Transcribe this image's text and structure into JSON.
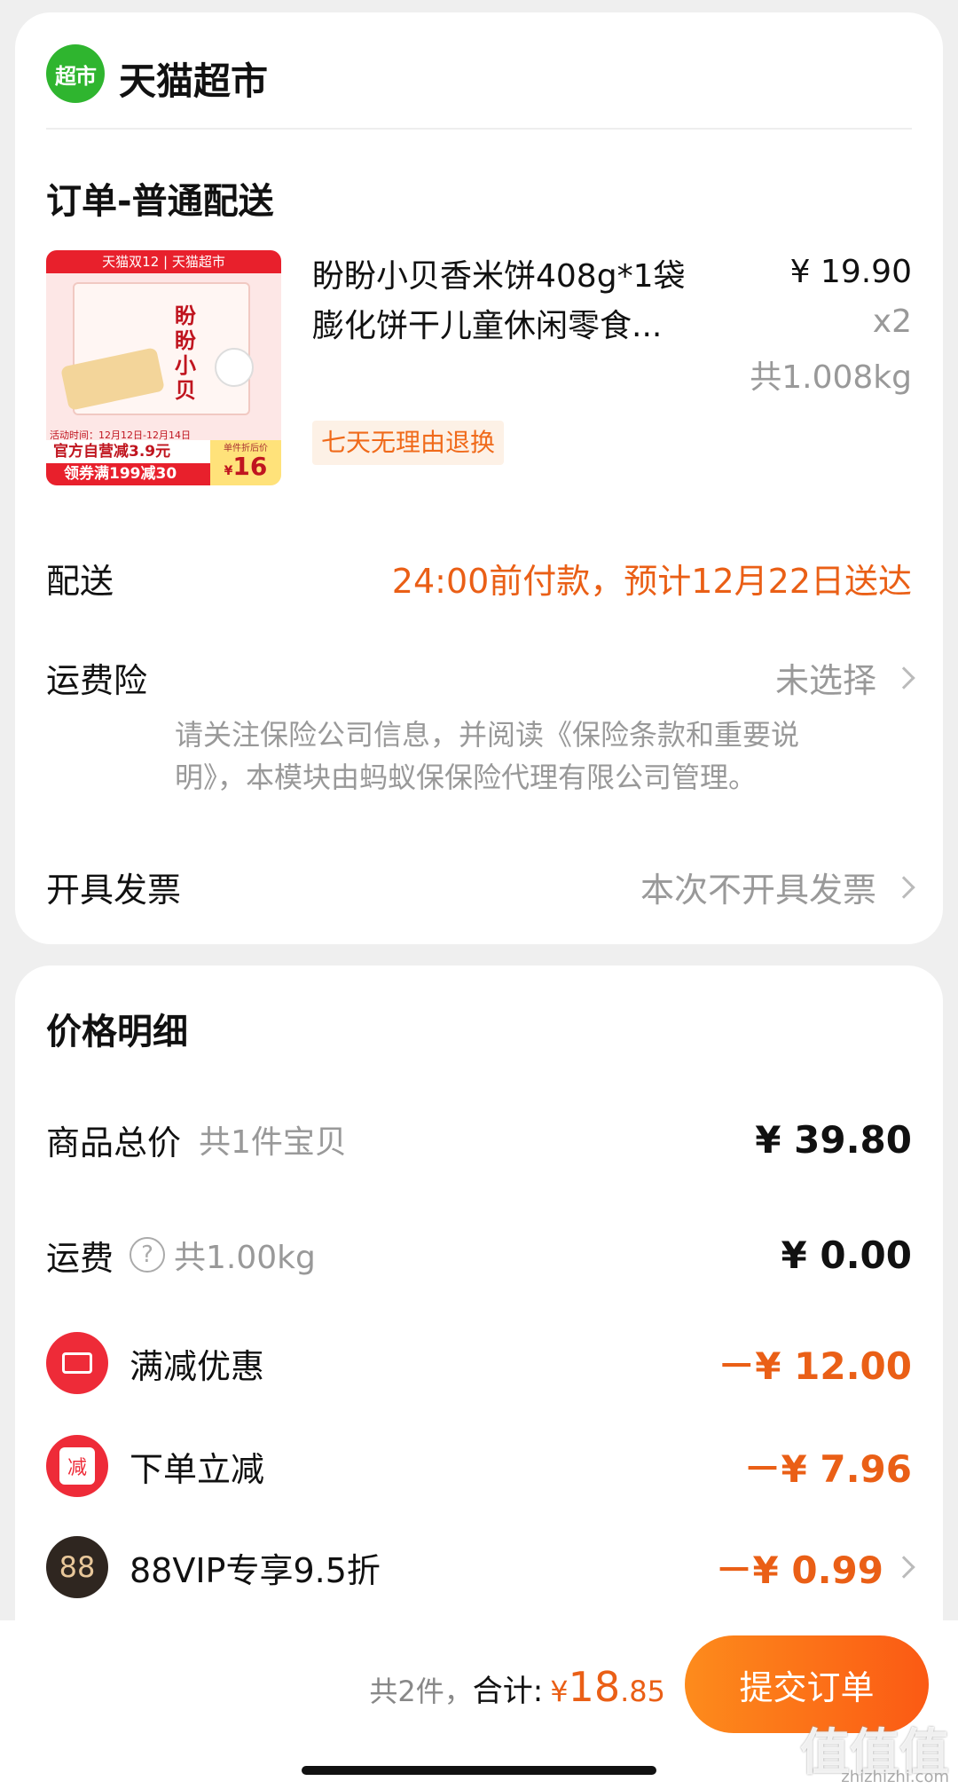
{
  "store": {
    "logo_text": "超市",
    "name": "天猫超市"
  },
  "order": {
    "title": "订单-普通配送",
    "thumbnail": {
      "banner": "天猫双12 | 天猫超市",
      "brand_text": "盼盼小贝",
      "event_dates": "活动时间：12月12日-12月14日",
      "promo1": "官方自营减3.9元",
      "promo2": "领券满199减30",
      "unit_label": "单件折后价",
      "unit_price": "16",
      "yen": "¥"
    },
    "product": {
      "name": "盼盼小贝香米饼408g*1袋膨化饼干儿童休闲零食...",
      "price": "¥ 19.90",
      "qty": "x2",
      "weight": "共1.008kg",
      "tag": "七天无理由退换"
    },
    "delivery": {
      "label": "配送",
      "value": "24:00前付款，预计12月22日送达"
    },
    "insurance": {
      "label": "运费险",
      "value": "未选择",
      "note": "请关注保险公司信息，并阅读《保险条款和重要说明》，本模块由蚂蚁保保险代理有限公司管理。"
    },
    "invoice": {
      "label": "开具发票",
      "value": "本次不开具发票"
    }
  },
  "pricing": {
    "title": "价格明细",
    "total": {
      "label": "商品总价",
      "sub": "共1件宝贝",
      "amount": "¥ 39.80"
    },
    "shipping": {
      "label": "运费",
      "sub": "共1.00kg",
      "amount": "¥ 0.00"
    },
    "discount1": {
      "label": "满减优惠",
      "amount": "－¥ 12.00"
    },
    "discount2": {
      "label": "下单立减",
      "icon_text": "减",
      "amount": "－¥ 7.96"
    },
    "discount3": {
      "label": "88VIP专享9.5折",
      "icon_text": "88",
      "amount": "－¥ 0.99"
    }
  },
  "footer": {
    "count": "共2件，",
    "total_label": "合计:",
    "currency": "¥",
    "total_int": "18",
    "total_dec": ".85",
    "submit": "提交订单"
  },
  "watermark": {
    "logo": "值值值",
    "url": "zhizhizhi.com"
  },
  "colors": {
    "accent": "#ea5f16",
    "brand_green": "#2fb52f",
    "submit_gradient": [
      "#fd8b1c",
      "#fb5a14"
    ]
  }
}
